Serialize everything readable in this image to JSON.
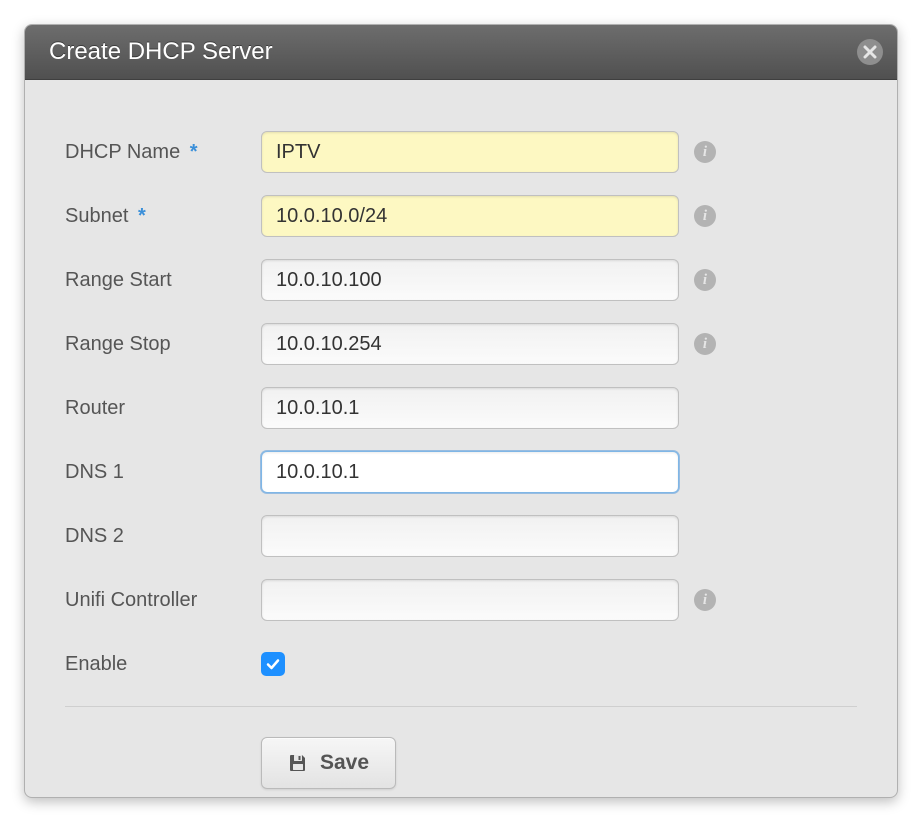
{
  "modal": {
    "title": "Create DHCP Server",
    "close_label": "close",
    "fields": {
      "dhcp_name": {
        "label": "DHCP Name",
        "required": true,
        "value": "IPTV",
        "has_info": true
      },
      "subnet": {
        "label": "Subnet",
        "required": true,
        "value": "10.0.10.0/24",
        "has_info": true
      },
      "range_start": {
        "label": "Range Start",
        "required": false,
        "value": "10.0.10.100",
        "has_info": true
      },
      "range_stop": {
        "label": "Range Stop",
        "required": false,
        "value": "10.0.10.254",
        "has_info": true
      },
      "router": {
        "label": "Router",
        "required": false,
        "value": "10.0.10.1",
        "has_info": false
      },
      "dns1": {
        "label": "DNS 1",
        "required": false,
        "value": "10.0.10.1",
        "has_info": false
      },
      "dns2": {
        "label": "DNS 2",
        "required": false,
        "value": "",
        "has_info": false
      },
      "unifi": {
        "label": "Unifi Controller",
        "required": false,
        "value": "",
        "has_info": true
      },
      "enable": {
        "label": "Enable",
        "checked": true
      }
    },
    "required_marker": "*",
    "save_label": "Save"
  }
}
